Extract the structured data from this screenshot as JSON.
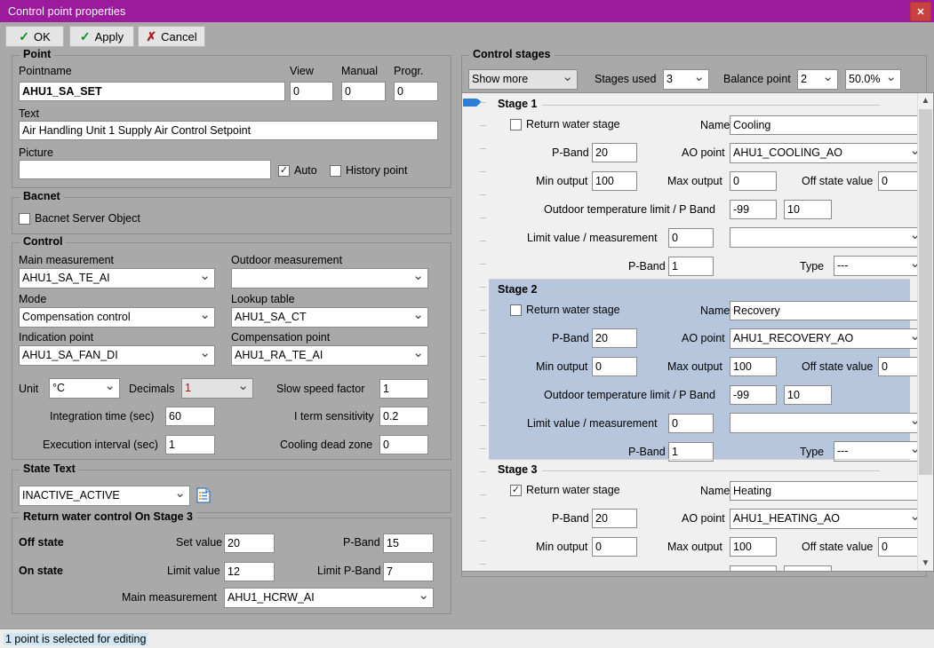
{
  "window": {
    "title": "Control point properties",
    "close_label": "✕",
    "accent": "#9c1a9c"
  },
  "toolbar": {
    "ok": "OK",
    "apply": "Apply",
    "cancel": "Cancel"
  },
  "point": {
    "legend": "Point",
    "pointname_label": "Pointname",
    "pointname_value": "AHU1_SA_SET",
    "view_label": "View",
    "view_value": "0",
    "manual_label": "Manual",
    "manual_value": "0",
    "progr_label": "Progr.",
    "progr_value": "0",
    "text_label": "Text",
    "text_value": "Air Handling Unit 1 Supply Air Control Setpoint",
    "picture_label": "Picture",
    "picture_value": "",
    "auto_label": "Auto",
    "auto_checked": true,
    "history_label": "History point",
    "history_checked": false
  },
  "bacnet": {
    "legend": "Bacnet",
    "server_object_label": "Bacnet Server Object",
    "server_object_checked": false
  },
  "control": {
    "legend": "Control",
    "main_measurement_label": "Main measurement",
    "main_measurement_value": "AHU1_SA_TE_AI",
    "outdoor_measurement_label": "Outdoor measurement",
    "outdoor_measurement_value": "",
    "mode_label": "Mode",
    "mode_value": "Compensation control",
    "lookup_table_label": "Lookup table",
    "lookup_table_value": "AHU1_SA_CT",
    "indication_point_label": "Indication point",
    "indication_point_value": "AHU1_SA_FAN_DI",
    "compensation_point_label": "Compensation point",
    "compensation_point_value": "AHU1_RA_TE_AI",
    "unit_label": "Unit",
    "unit_value": "°C",
    "decimals_label": "Decimals",
    "decimals_value": "1",
    "decimals_color": "#d40000",
    "slow_speed_label": "Slow speed factor",
    "slow_speed_value": "1",
    "integration_label": "Integration time (sec)",
    "integration_value": "60",
    "iterm_label": "I term sensitivity",
    "iterm_value": "0.2",
    "execution_label": "Execution interval (sec)",
    "execution_value": "1",
    "cooling_dead_label": "Cooling dead zone",
    "cooling_dead_value": "0"
  },
  "state_text": {
    "legend": "State Text",
    "value": "INACTIVE_ACTIVE",
    "icon": "document-list-icon"
  },
  "return_water": {
    "legend": "Return water control On Stage 3",
    "off_state_label": "Off state",
    "set_value_label": "Set value",
    "set_value": "20",
    "pband_label": "P-Band",
    "pband_value": "15",
    "on_state_label": "On state",
    "limit_value_label": "Limit value",
    "limit_value": "12",
    "limit_pband_label": "Limit P-Band",
    "limit_pband_value": "7",
    "main_measurement_label": "Main measurement",
    "main_measurement_value": "AHU1_HCRW_AI"
  },
  "control_stages": {
    "legend": "Control stages",
    "show_more": "Show more",
    "stages_used_label": "Stages used",
    "stages_used_value": "3",
    "balance_point_label": "Balance point",
    "balance_point_value": "2",
    "balance_percent_value": "50.0%",
    "labels": {
      "return_water_stage": "Return water stage",
      "name": "Name",
      "pband": "P-Band",
      "ao_point": "AO point",
      "min_output": "Min output",
      "max_output": "Max output",
      "off_state_value": "Off state value",
      "outdoor_limit": "Outdoor temperature limit / P Band",
      "limit_value_measurement": "Limit value / measurement",
      "type": "Type"
    },
    "stages": [
      {
        "title": "Stage 1",
        "selected": false,
        "return_water_stage": false,
        "name": "Cooling",
        "pband": "20",
        "ao_point": "AHU1_COOLING_AO",
        "min_output": "100",
        "max_output": "0",
        "off_state_value": "0",
        "outdoor_limit": "-99",
        "outdoor_pband": "10",
        "limit_value": "0",
        "limit_measurement": "",
        "pband2": "1",
        "type": "---"
      },
      {
        "title": "Stage 2",
        "selected": true,
        "return_water_stage": false,
        "name": "Recovery",
        "pband": "20",
        "ao_point": "AHU1_RECOVERY_AO",
        "min_output": "0",
        "max_output": "100",
        "off_state_value": "0",
        "outdoor_limit": "-99",
        "outdoor_pband": "10",
        "limit_value": "0",
        "limit_measurement": "",
        "pband2": "1",
        "type": "---"
      },
      {
        "title": "Stage 3",
        "selected": false,
        "return_water_stage": true,
        "name": "Heating",
        "pband": "20",
        "ao_point": "AHU1_HEATING_AO",
        "min_output": "0",
        "max_output": "100",
        "off_state_value": "0",
        "outdoor_limit": "",
        "outdoor_pband": "",
        "limit_value": "",
        "limit_measurement": "",
        "pband2": "",
        "type": ""
      }
    ]
  },
  "statusbar": {
    "message": "1 point is selected for editing"
  }
}
